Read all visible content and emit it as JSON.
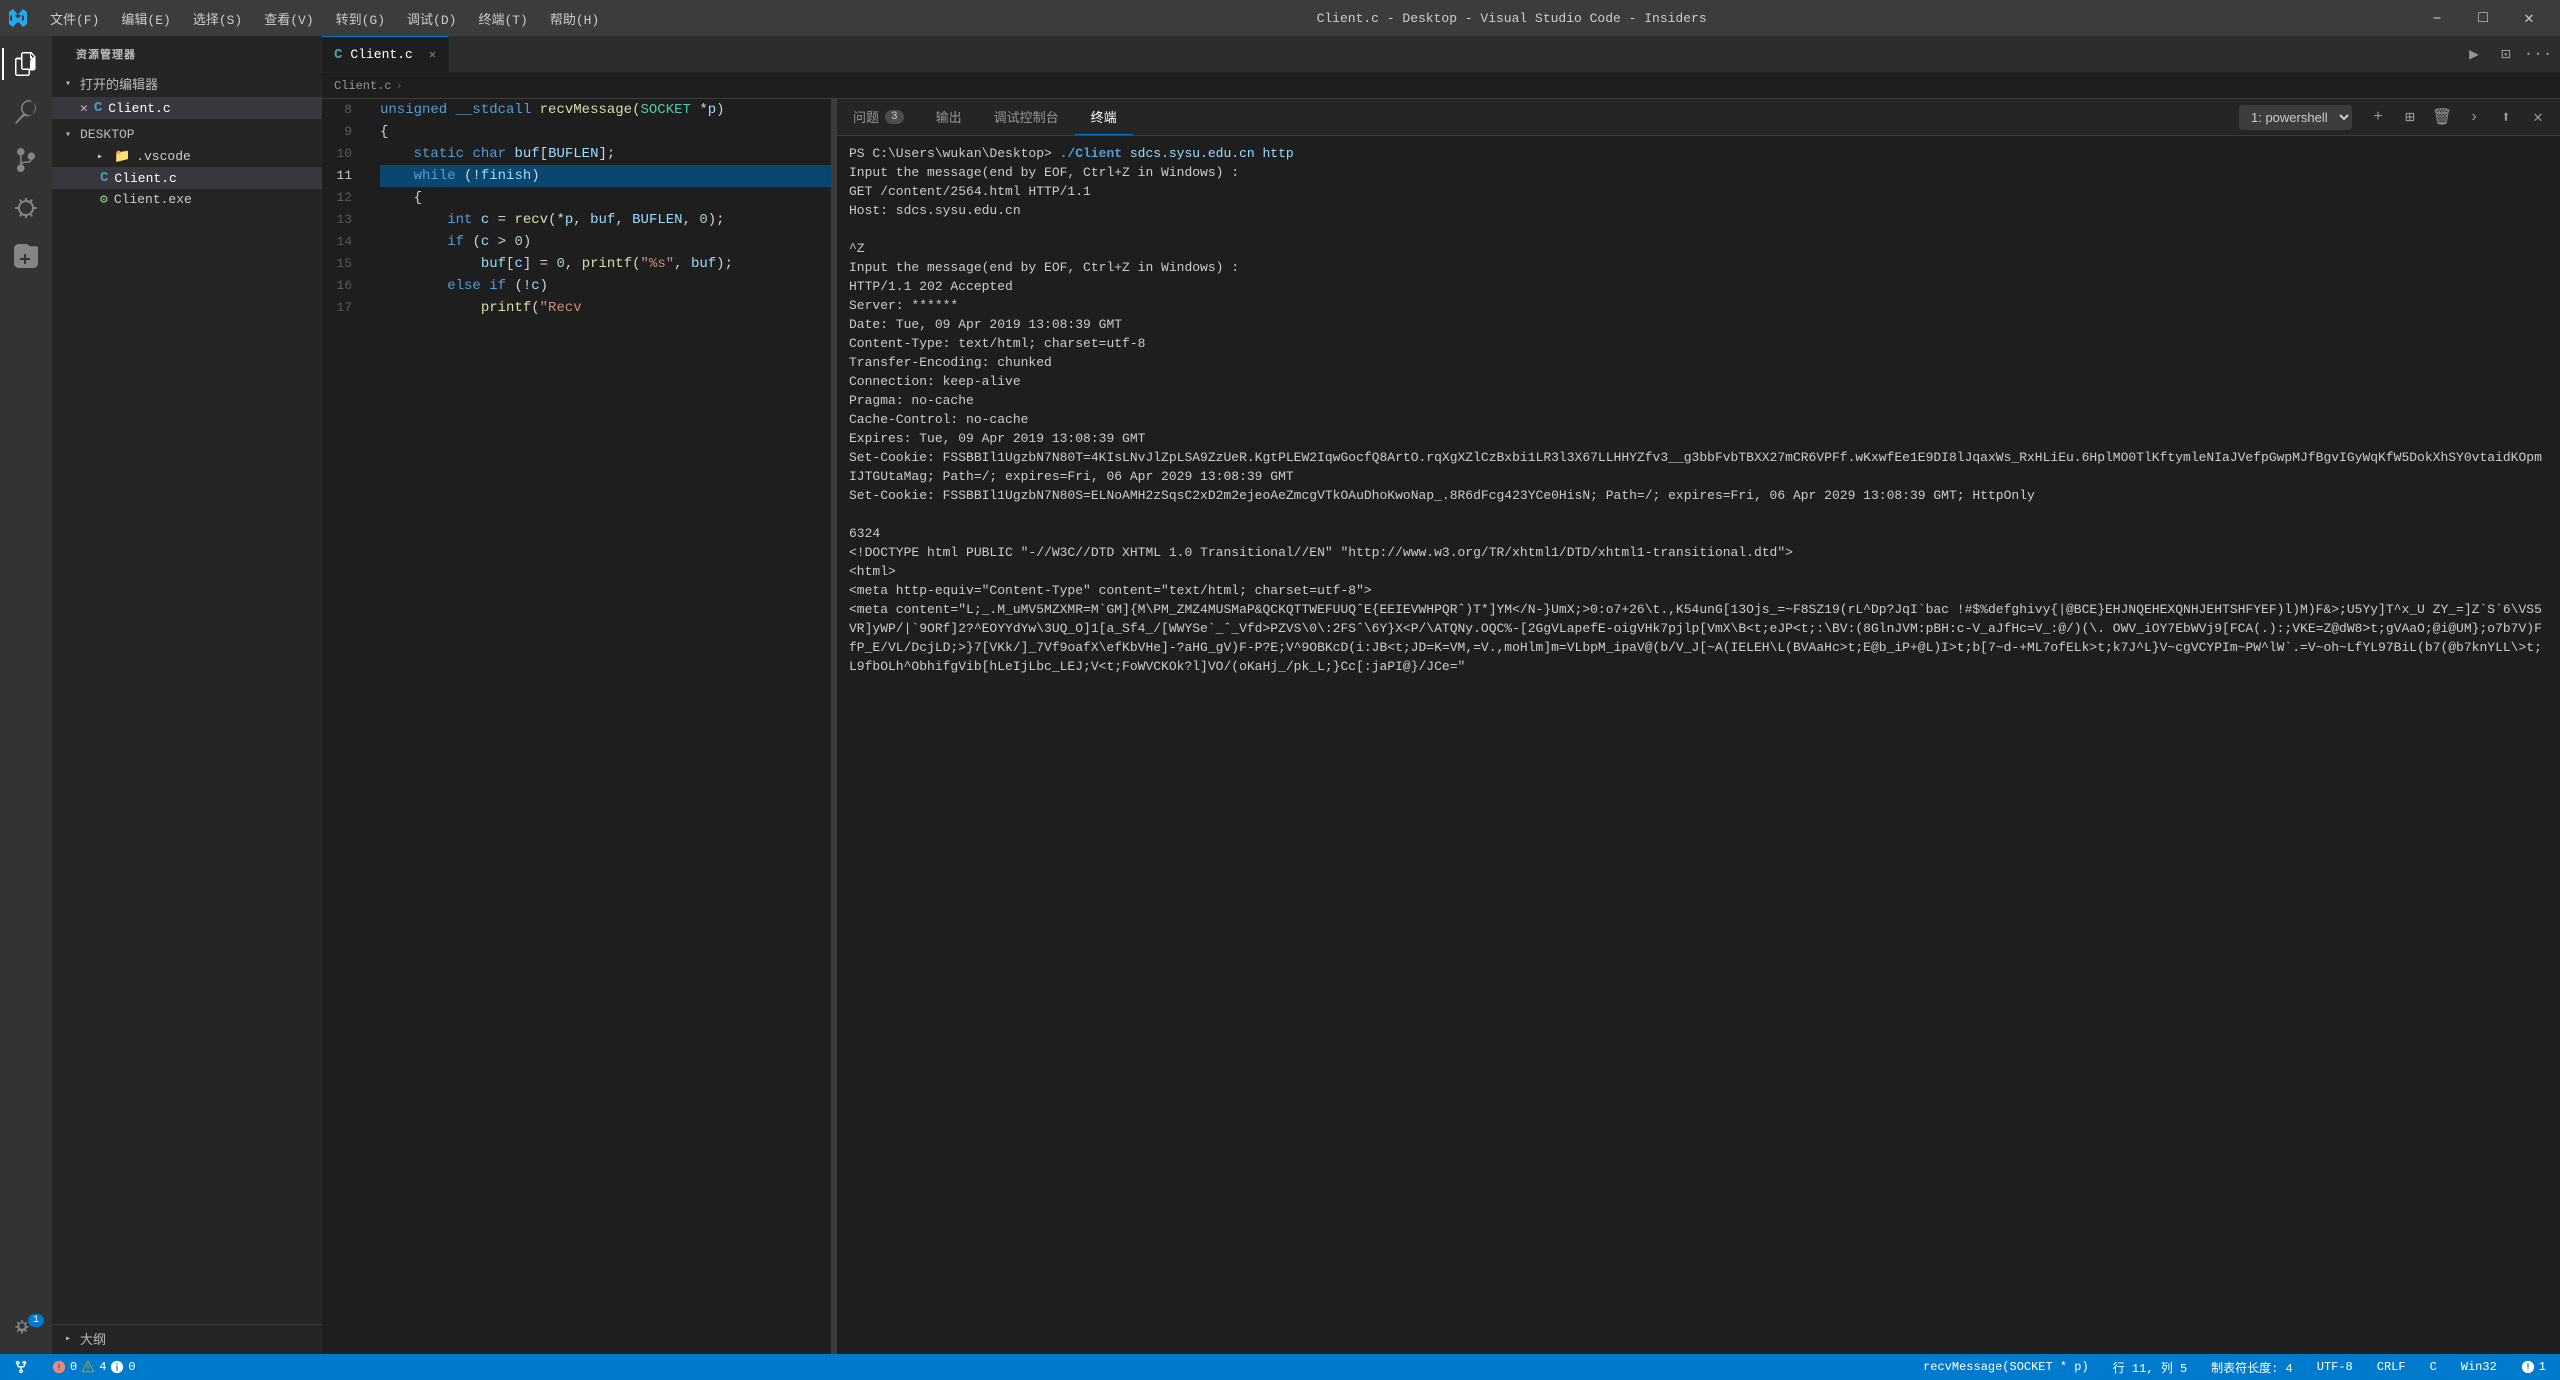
{
  "titlebar": {
    "title": "Client.c - Desktop - Visual Studio Code - Insiders",
    "menu_items": [
      "文件(F)",
      "编辑(E)",
      "选择(S)",
      "查看(V)",
      "转到(G)",
      "调试(D)",
      "终端(T)",
      "帮助(H)"
    ]
  },
  "sidebar": {
    "header": "资源管理器",
    "sections": {
      "open_editors": "打开的编辑器",
      "desktop": "DESKTOP"
    },
    "open_files": [
      {
        "name": "Client.c",
        "icon": "c",
        "modified": false
      }
    ],
    "tree": [
      {
        "name": ".vscode",
        "type": "folder",
        "indent": 1
      },
      {
        "name": "Client.c",
        "type": "c",
        "indent": 1
      },
      {
        "name": "Client.exe",
        "type": "exe",
        "indent": 1
      }
    ],
    "outline": "大纲"
  },
  "editor": {
    "tab_label": "Client.c",
    "breadcrumb": "Client.c",
    "lines": [
      {
        "num": 8,
        "code": "unsigned __stdcall recvMessage(SOCKET *p)"
      },
      {
        "num": 9,
        "code": "{"
      },
      {
        "num": 10,
        "code": "    static char buf[BUFLEN];"
      },
      {
        "num": 11,
        "code": "    while (!finish)"
      },
      {
        "num": 12,
        "code": "    {"
      },
      {
        "num": 13,
        "code": "        int c = recv(*p, buf, BUFLEN, 0);"
      },
      {
        "num": 14,
        "code": "        if (c > 0)"
      },
      {
        "num": 15,
        "code": "            buf[c] = 0, printf(\"%s\", buf);"
      },
      {
        "num": 16,
        "code": "        else if (!c)"
      },
      {
        "num": 17,
        "code": "            printf(\"Recv"
      }
    ]
  },
  "panel": {
    "tabs": [
      "问题",
      "输出",
      "调试控制台",
      "终端"
    ],
    "active_tab": "终端",
    "problems_count": 3,
    "terminal_name": "1: powershell"
  },
  "terminal": {
    "lines": [
      "PS C:\\Users\\wukan\\Desktop> ./Client sdcs.sysu.edu.cn http",
      "Input the message(end by EOF, Ctrl+Z in Windows) :",
      "GET /content/2564.html HTTP/1.1",
      "Host: sdcs.sysu.edu.cn",
      "",
      "^Z",
      "Input the message(end by EOF, Ctrl+Z in Windows) :",
      "HTTP/1.1 202 Accepted",
      "Server: ******",
      "Date: Tue, 09 Apr 2019 13:08:39 GMT",
      "Content-Type: text/html; charset=utf-8",
      "Transfer-Encoding: chunked",
      "Connection: keep-alive",
      "Pragma: no-cache",
      "Cache-Control: no-cache",
      "Expires: Tue, 09 Apr 2019 13:08:39 GMT",
      "Set-Cookie: FSSBBIl1UgzbN7N80T=4KIsLNvJlZpLSA9ZzUeR.KgtPLEW2IqwGocfQ8ArtO.rqXgXZlCzBxbi1LR3l3X67LLHHYZfv3__g3bbFvbTBXX27mCR6VPFf.wKxwfEe1E9DI8lJqaxWs_RxHLiEu.6HplMO0TlKftymleNIaJVefpGwpMJfBgvIGyWqKfW5DokXhSY0vtaidKOpmIJTGUtaMag; Path=/; expires=Fri, 06 Apr 2029 13:08:39 GMT",
      "Set-Cookie: FSSBBIl1UgzbN7N80S=ELNoAMH2zSqsC2xD2m2ejeoAeZmcgVTkOAuDhoKwoNap_.8R6dFcg423YCe0HisN; Path=/; expires=Fri, 06 Apr 2029 13:08:39 GMT; HttpOnly",
      "",
      "6324",
      "<!DOCTYPE html PUBLIC \"-//W3C//DTD XHTML 1.0 Transitional//EN\" \"http://www.w3.org/TR/xhtml1/DTD/xhtml1-transitional.dtd\">",
      "<html>",
      "<meta http-equiv=\"Content-Type\" content=\"text/html; charset=utf-8\">",
      "<meta content=\"L;_.M_uMV5MZXMR=M`GM]{M\\PM_ZMZ4MUSMaP&amp;QCKQTTWEFUUQˆE{EEIEVWHPQRˆ)T*]YM&lt;/N-}UmX;&gt;0:o7+26\\t.,K54unG[13Ojs_=~F8SZ19(rL^Dp?JqI`bac !#$%defghivy{|@BCE}EHJNQEHEXQNHJEHTSHFYEF)l)M)F&amp;&gt;;U5Yy]T^x_U ZY_=]Z`S`6\\VS5VR]yWP/|`9ORf]2?^EOYYdYw\\3UQ_O]1[a_Sf4_/[WWYSe`_ˆ_Vfd&gt;PZVS\\0\\:2FSˆ\\6Y}X&lt;P/\\ATQNy.OQC%-[2GgVLapefE-oigVHk7pjlp[VmX\\B&lt;t;eJP&lt;t;:\\BV:(8GlnJVM:pBH:c-V_aJfHc=V_:@/)(\\.OWV_iOY7EbWVj9[FCA(.):;VKE=Z@dW8&gt;t;gVAaO;@i@UM};o7b7V)FfP_E/VL/DcjLD;&gt;}7[VKk/]_7Vf9oafX\\efKbVHe]-?aHG_gV)F-P?E;V^9OBKcD(i:JB&lt;t;JD=K=VM,=V.,moHlm]m=VLbpM_ipaV@(b/V_J[~A(IELEH\\L(BVAaHc&gt;t;E@b_iP+@L)I&gt;t;b[7~d-+ML7ofELk&gt;t;k7J^L}V~cgVCYPIm~PW^lW`.=V~oh~LfYL97BiL(b7(@b7knYLL\\&gt;t;L9fbOLh^ObhifgVib[hLeIjLbc_LEJ;V&lt;t;FoWVCKOk?l]VO/(oKaHj_/pk_L;}Cc[:jaPI@}/JCe=\""
    ]
  },
  "status_bar": {
    "errors": 0,
    "warnings": 4,
    "info": 0,
    "problems_total": 3,
    "function": "recvMessage(SOCKET * p)",
    "line": 11,
    "column": 5,
    "char_width": 4,
    "encoding": "UTF-8",
    "line_ending": "CRLF",
    "language": "C",
    "feedback": "Win32",
    "notification_count": 1
  }
}
